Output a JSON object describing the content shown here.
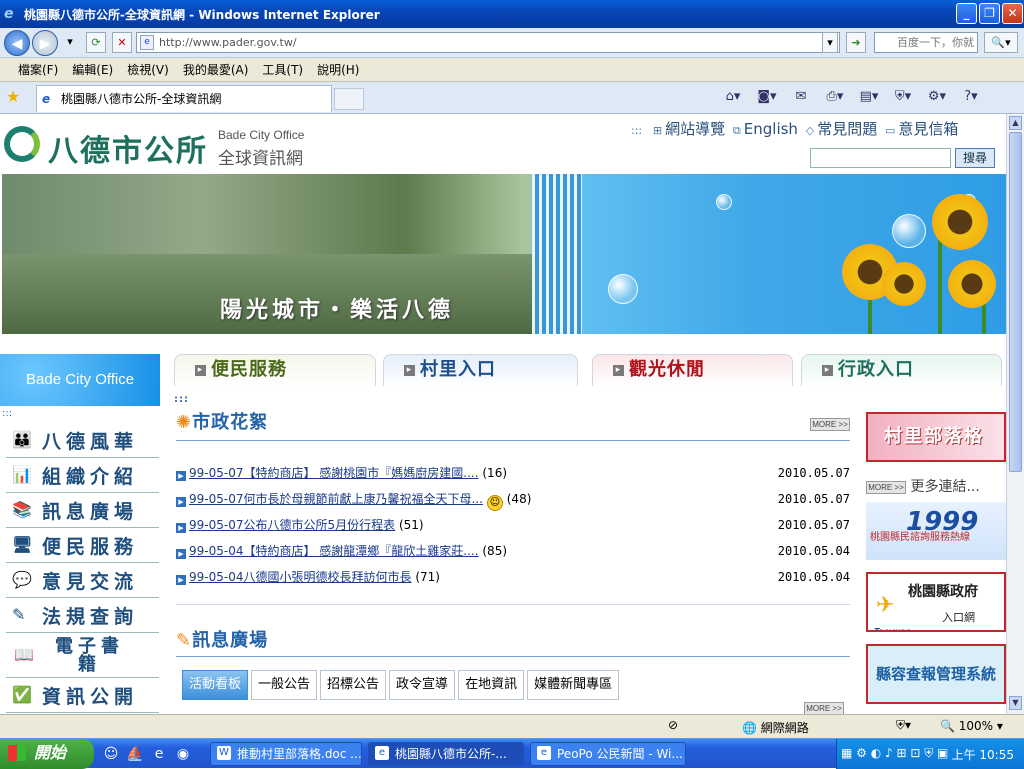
{
  "window": {
    "title": "桃園縣八德市公所-全球資訊網 - Windows Internet Explorer"
  },
  "addressbar": {
    "url": "http://www.pader.gov.tw/",
    "search_placeholder": "百度一下，你就"
  },
  "menubar": {
    "items": [
      "檔案(F)",
      "編輯(E)",
      "檢視(V)",
      "我的最愛(A)",
      "工具(T)",
      "說明(H)"
    ]
  },
  "tab": {
    "title": "桃園縣八德市公所-全球資訊網"
  },
  "site": {
    "logo_zh": "八德市公所",
    "logo_en": "Bade City Office",
    "logo_sub": "全球資訊網",
    "top_links": [
      "網站導覽",
      "English",
      "常見問題",
      "意見信箱"
    ],
    "search_button": "搜尋",
    "slogan": "陽光城市・樂活八德"
  },
  "leftnav": {
    "header": "Bade City Office",
    "items": [
      "八德風華",
      "組織介紹",
      "訊息廣場",
      "便民服務",
      "意見交流",
      "法規查詢",
      "電子書籍",
      "資訊公開"
    ]
  },
  "maintabs": [
    "便民服務",
    "村里入口",
    "觀光休閒",
    "行政入口"
  ],
  "news": {
    "heading": "市政花絮",
    "more": "MORE >>",
    "items": [
      {
        "title": "99-05-07【特約商店】 感謝桃園市『媽媽廚房建國....",
        "count": "(16)",
        "date": "2010.05.07"
      },
      {
        "title": "99-05-07何市長於母親節前獻上康乃馨祝福全天下母...",
        "count": "(48)",
        "date": "2010.05.07"
      },
      {
        "title": "99-05-07公布八德市公所5月份行程表",
        "count": "(51)",
        "date": "2010.05.07"
      },
      {
        "title": "99-05-04【特約商店】 感謝龍潭鄉『龍欣土雞家莊....",
        "count": "(85)",
        "date": "2010.05.04"
      },
      {
        "title": "99-05-04八德國小張明德校長拜訪何市長",
        "count": "(71)",
        "date": "2010.05.04"
      }
    ]
  },
  "infosquare": {
    "heading": "訊息廣場",
    "tabs": [
      "活動看板",
      "一般公告",
      "招標公告",
      "政令宣導",
      "在地資訊",
      "媒體新聞專區"
    ],
    "more": "MORE >>"
  },
  "rightlinks": {
    "village_blog": "村里部落格",
    "more_label": "MORE >>",
    "more_links": "更多連結...",
    "hotline_number": "1999",
    "hotline_caption": "桃園縣民諮詢服務熱線",
    "county_gov": "桃園縣政府",
    "county_gov_sub": "入口網",
    "county_gov_en": "Taoyuan",
    "appearance": "縣容查報管理系統"
  },
  "statusbar": {
    "zone": "網際網路",
    "zoom": "100%"
  },
  "taskbar": {
    "start": "開始",
    "tasks": [
      "推動村里部落格.doc ...",
      "桃園縣八德市公所-...",
      "PeoPo 公民新聞 - Wi..."
    ],
    "clock": "上午 10:55"
  }
}
